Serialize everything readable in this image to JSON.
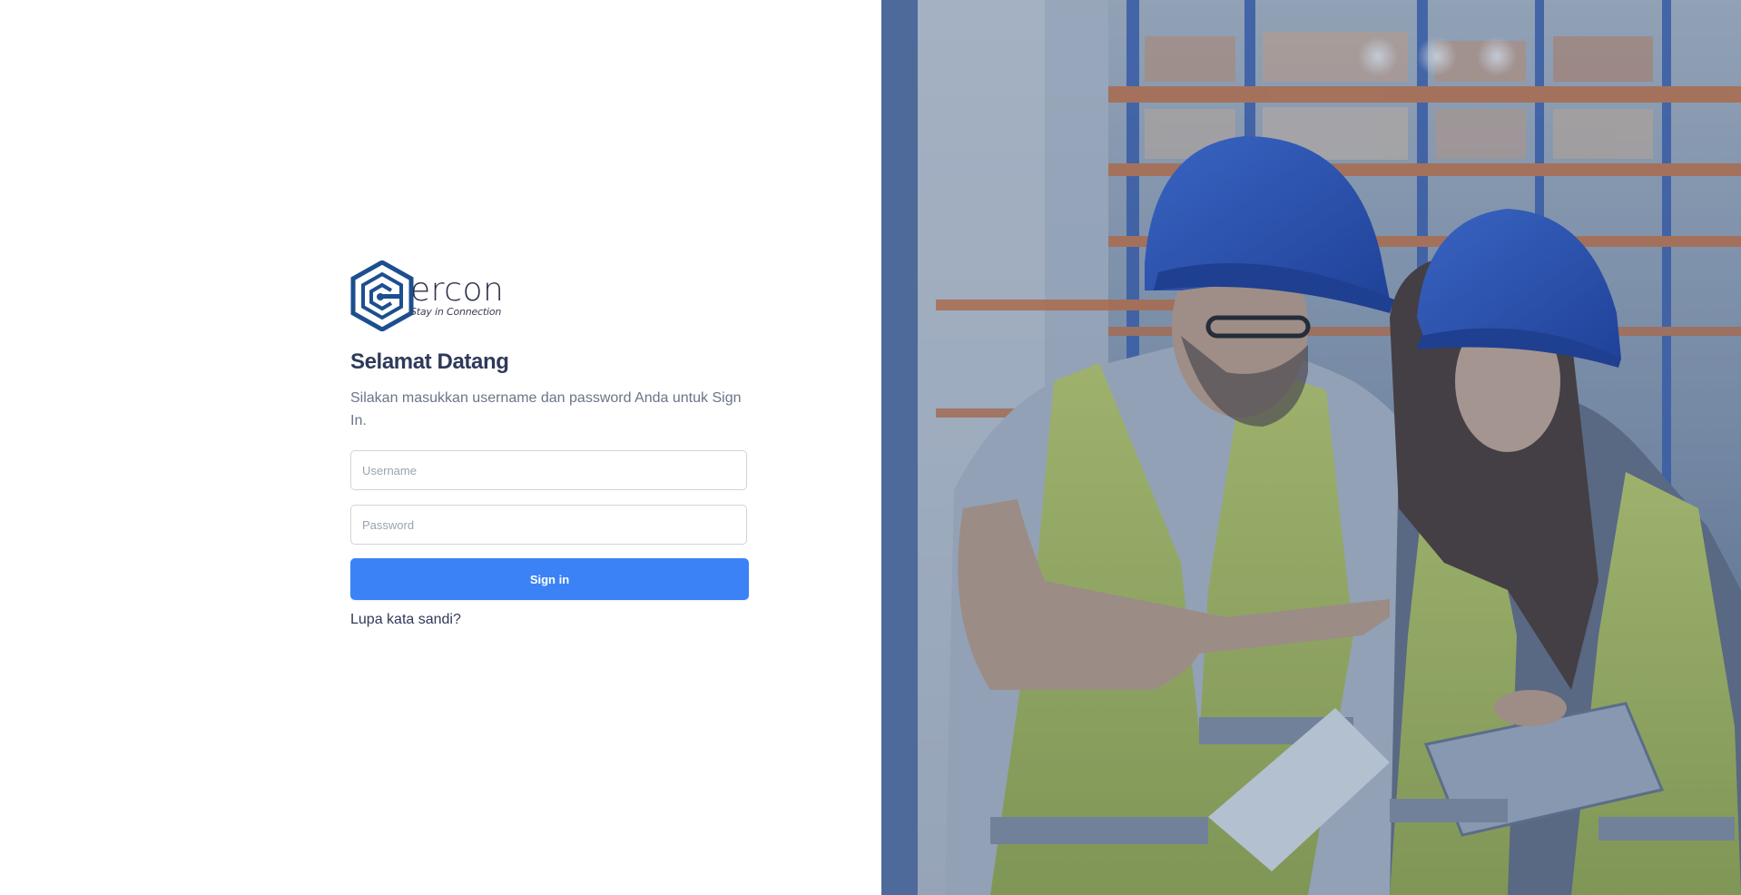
{
  "brand": {
    "name": "ercon",
    "tagline": "Stay in Connection",
    "color": "#1d4f8f"
  },
  "login": {
    "title": "Selamat Datang",
    "subtitle": "Silakan masukkan username dan password Anda untuk Sign In.",
    "username_placeholder": "Username",
    "username_value": "",
    "password_placeholder": "Password",
    "password_value": "",
    "signin_label": "Sign in",
    "forgot_label": "Lupa kata sandi?"
  },
  "hero": {
    "icon": "warehouse-workers-photo",
    "overlay_color": "#2f4a78"
  },
  "colors": {
    "accent": "#3b82f6",
    "heading": "#2e3a59",
    "muted": "#6b7588"
  }
}
